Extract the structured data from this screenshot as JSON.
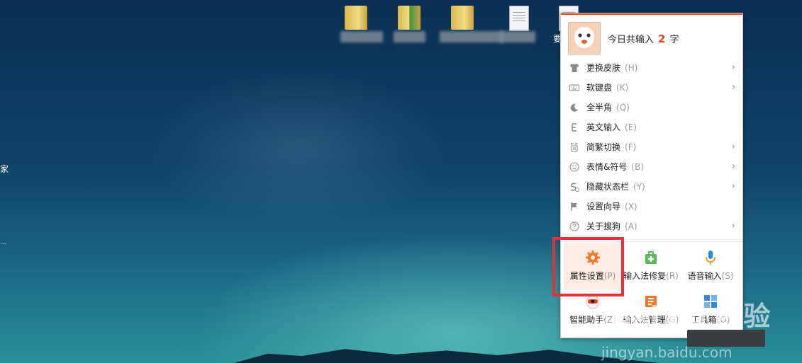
{
  "desktop": {
    "left_edge_text": "家",
    "left_edge_text_2": "...",
    "partial_icon_label": "要",
    "icons": [
      {
        "icon": "folder-icon"
      },
      {
        "icon": "excel-folder-icon"
      },
      {
        "icon": "folder-icon"
      },
      {
        "icon": "document-icon"
      },
      {
        "icon": "document-icon"
      }
    ]
  },
  "ime_menu": {
    "accent": "#e84f1c",
    "header": {
      "prefix": "今日共输入",
      "count": "2",
      "suffix": "字"
    },
    "items": [
      {
        "icon": "shirt-icon",
        "label": "更换皮肤",
        "key": "(H)",
        "arrow": true
      },
      {
        "icon": "keyboard-icon",
        "label": "软键盘",
        "key": "(K)",
        "arrow": true
      },
      {
        "icon": "moon-icon",
        "label": "全半角",
        "key": "(Q)",
        "arrow": false
      },
      {
        "icon": "letter-e-icon",
        "label": "英文输入",
        "key": "(E)",
        "arrow": false
      },
      {
        "icon": "simplified-traditional-icon",
        "label": "简繁切换",
        "key": "(F)",
        "arrow": true
      },
      {
        "icon": "smiley-icon",
        "label": "表情&符号",
        "key": "(B)",
        "arrow": true
      },
      {
        "icon": "hide-statusbar-icon",
        "label": "隐藏状态栏",
        "key": "(Y)",
        "arrow": true
      },
      {
        "icon": "flag-icon",
        "label": "设置向导",
        "key": "(X)",
        "arrow": false
      },
      {
        "icon": "question-icon",
        "label": "关于搜狗",
        "key": "(A)",
        "arrow": true
      }
    ],
    "tiles": [
      {
        "icon": "gear-icon",
        "label": "属性设置",
        "key": "(P)",
        "color": "#f07a2a"
      },
      {
        "icon": "repair-kit-icon",
        "label": "输入法修复",
        "key": "(R)",
        "color": "#5cb85c"
      },
      {
        "icon": "microphone-icon",
        "label": "语音输入",
        "key": "(S)",
        "color": "#2b8be0"
      },
      {
        "icon": "assistant-icon",
        "label": "智能助手",
        "key": "(Z)",
        "color": "#e8461a"
      },
      {
        "icon": "manager-icon",
        "label": "输入法管理",
        "key": "(G)",
        "color": "#f07a2a"
      },
      {
        "icon": "toolbox-icon",
        "label": "工具箱",
        "key": "(O)",
        "color": "#2b8be0"
      }
    ],
    "arrow_glyph": "›"
  },
  "watermark": {
    "text": "Bai du 经验",
    "url_text": "jingyan.baidu.com"
  }
}
